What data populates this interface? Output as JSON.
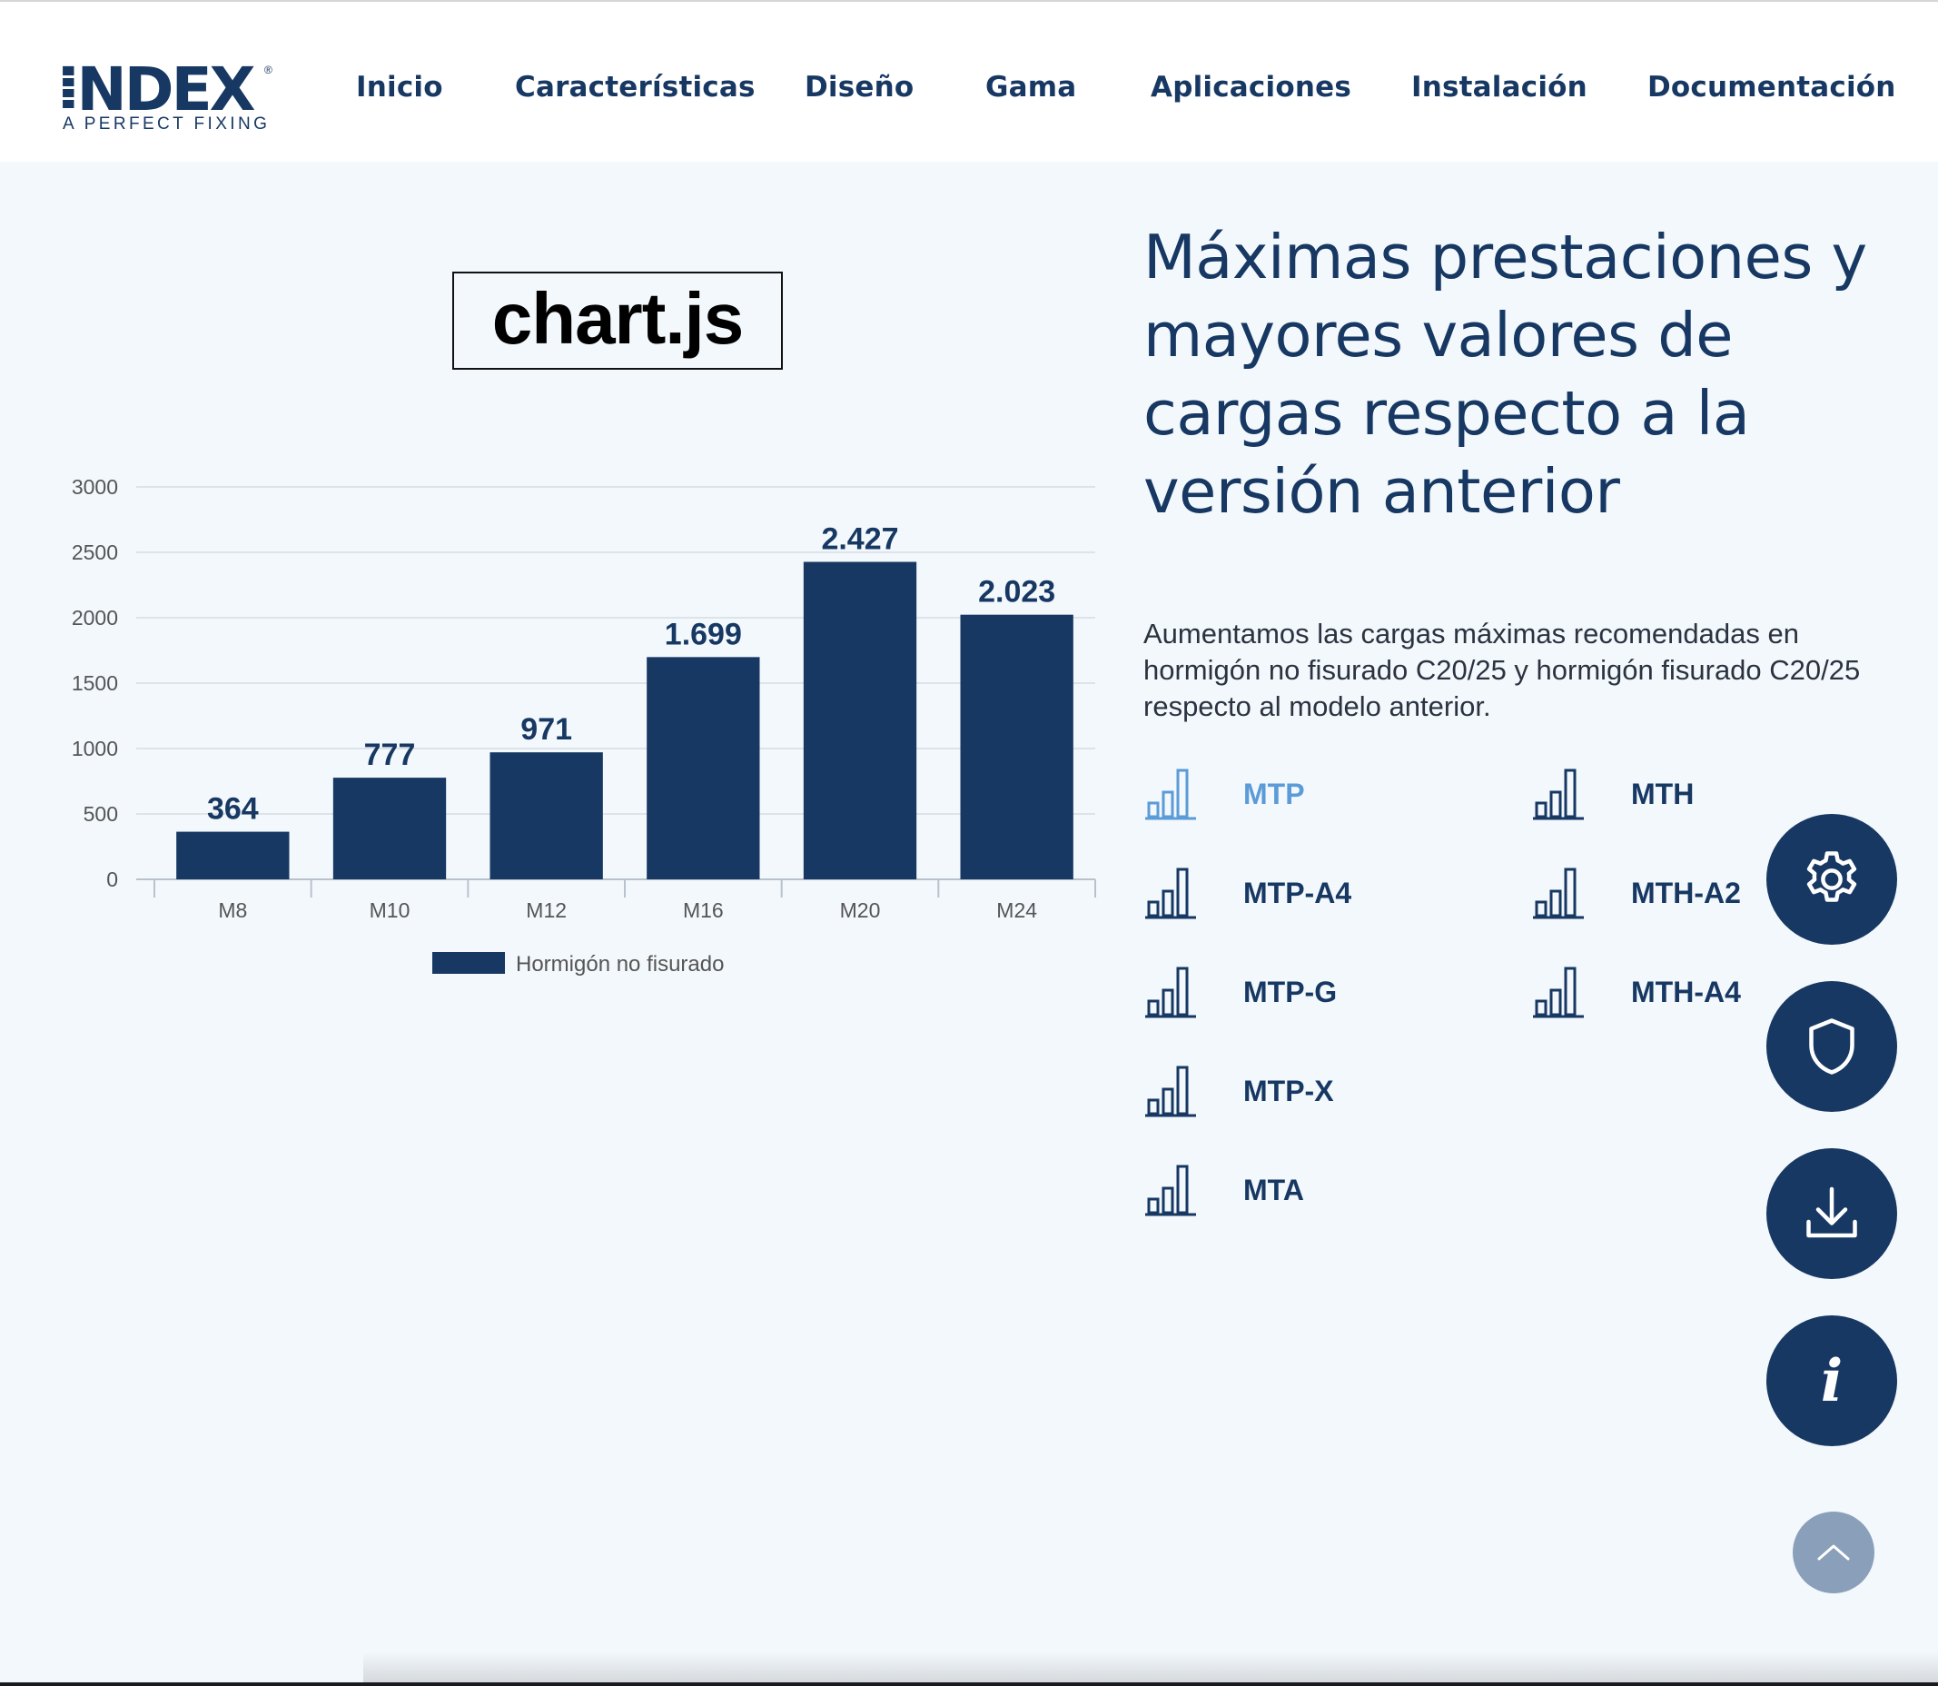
{
  "header": {
    "logo": {
      "word": "INDEX",
      "reg": "®",
      "tagline": "A PERFECT FIXING"
    },
    "nav": [
      "Inicio",
      "Características",
      "Diseño",
      "Gama",
      "Aplicaciones",
      "Instalación",
      "Documentación"
    ]
  },
  "placeholder_label": "chart.js",
  "main": {
    "headline": "Máximas prestaciones y mayores valores de cargas respecto a la versión anterior",
    "description": "Aumentamos las cargas máximas recomendadas en hormigón no fisurado C20/25 y hormigón fisurado C20/25 respecto al modelo anterior.",
    "models_left": [
      "MTP",
      "MTP-A4",
      "MTP-G",
      "MTP-X",
      "MTA"
    ],
    "models_right": [
      "MTH",
      "MTH-A2",
      "MTH-A4"
    ],
    "active_model": "MTP"
  },
  "fab": {
    "icons": [
      "gear-icon",
      "shield-icon",
      "download-icon",
      "info-icon"
    ],
    "info_glyph": "i",
    "scroll_top_icon": "chevron-up-icon"
  },
  "colors": {
    "brand": "#173863",
    "active": "#5b9bd8",
    "background": "#f3f8fc",
    "scroll_top": "#8a9fba"
  },
  "chart_data": {
    "type": "bar",
    "categories": [
      "M8",
      "M10",
      "M12",
      "M16",
      "M20",
      "M24"
    ],
    "series": [
      {
        "name": "Hormigón no fisurado",
        "values": [
          364,
          777,
          971,
          1699,
          2427,
          2023
        ]
      }
    ],
    "data_labels": [
      "364",
      "777",
      "971",
      "1.699",
      "2.427",
      "2.023"
    ],
    "y_ticks": [
      0,
      500,
      1000,
      1500,
      2000,
      2500,
      3000
    ],
    "ylim": [
      0,
      3000
    ],
    "grid": true,
    "legend_position": "bottom",
    "color": "#173863"
  }
}
